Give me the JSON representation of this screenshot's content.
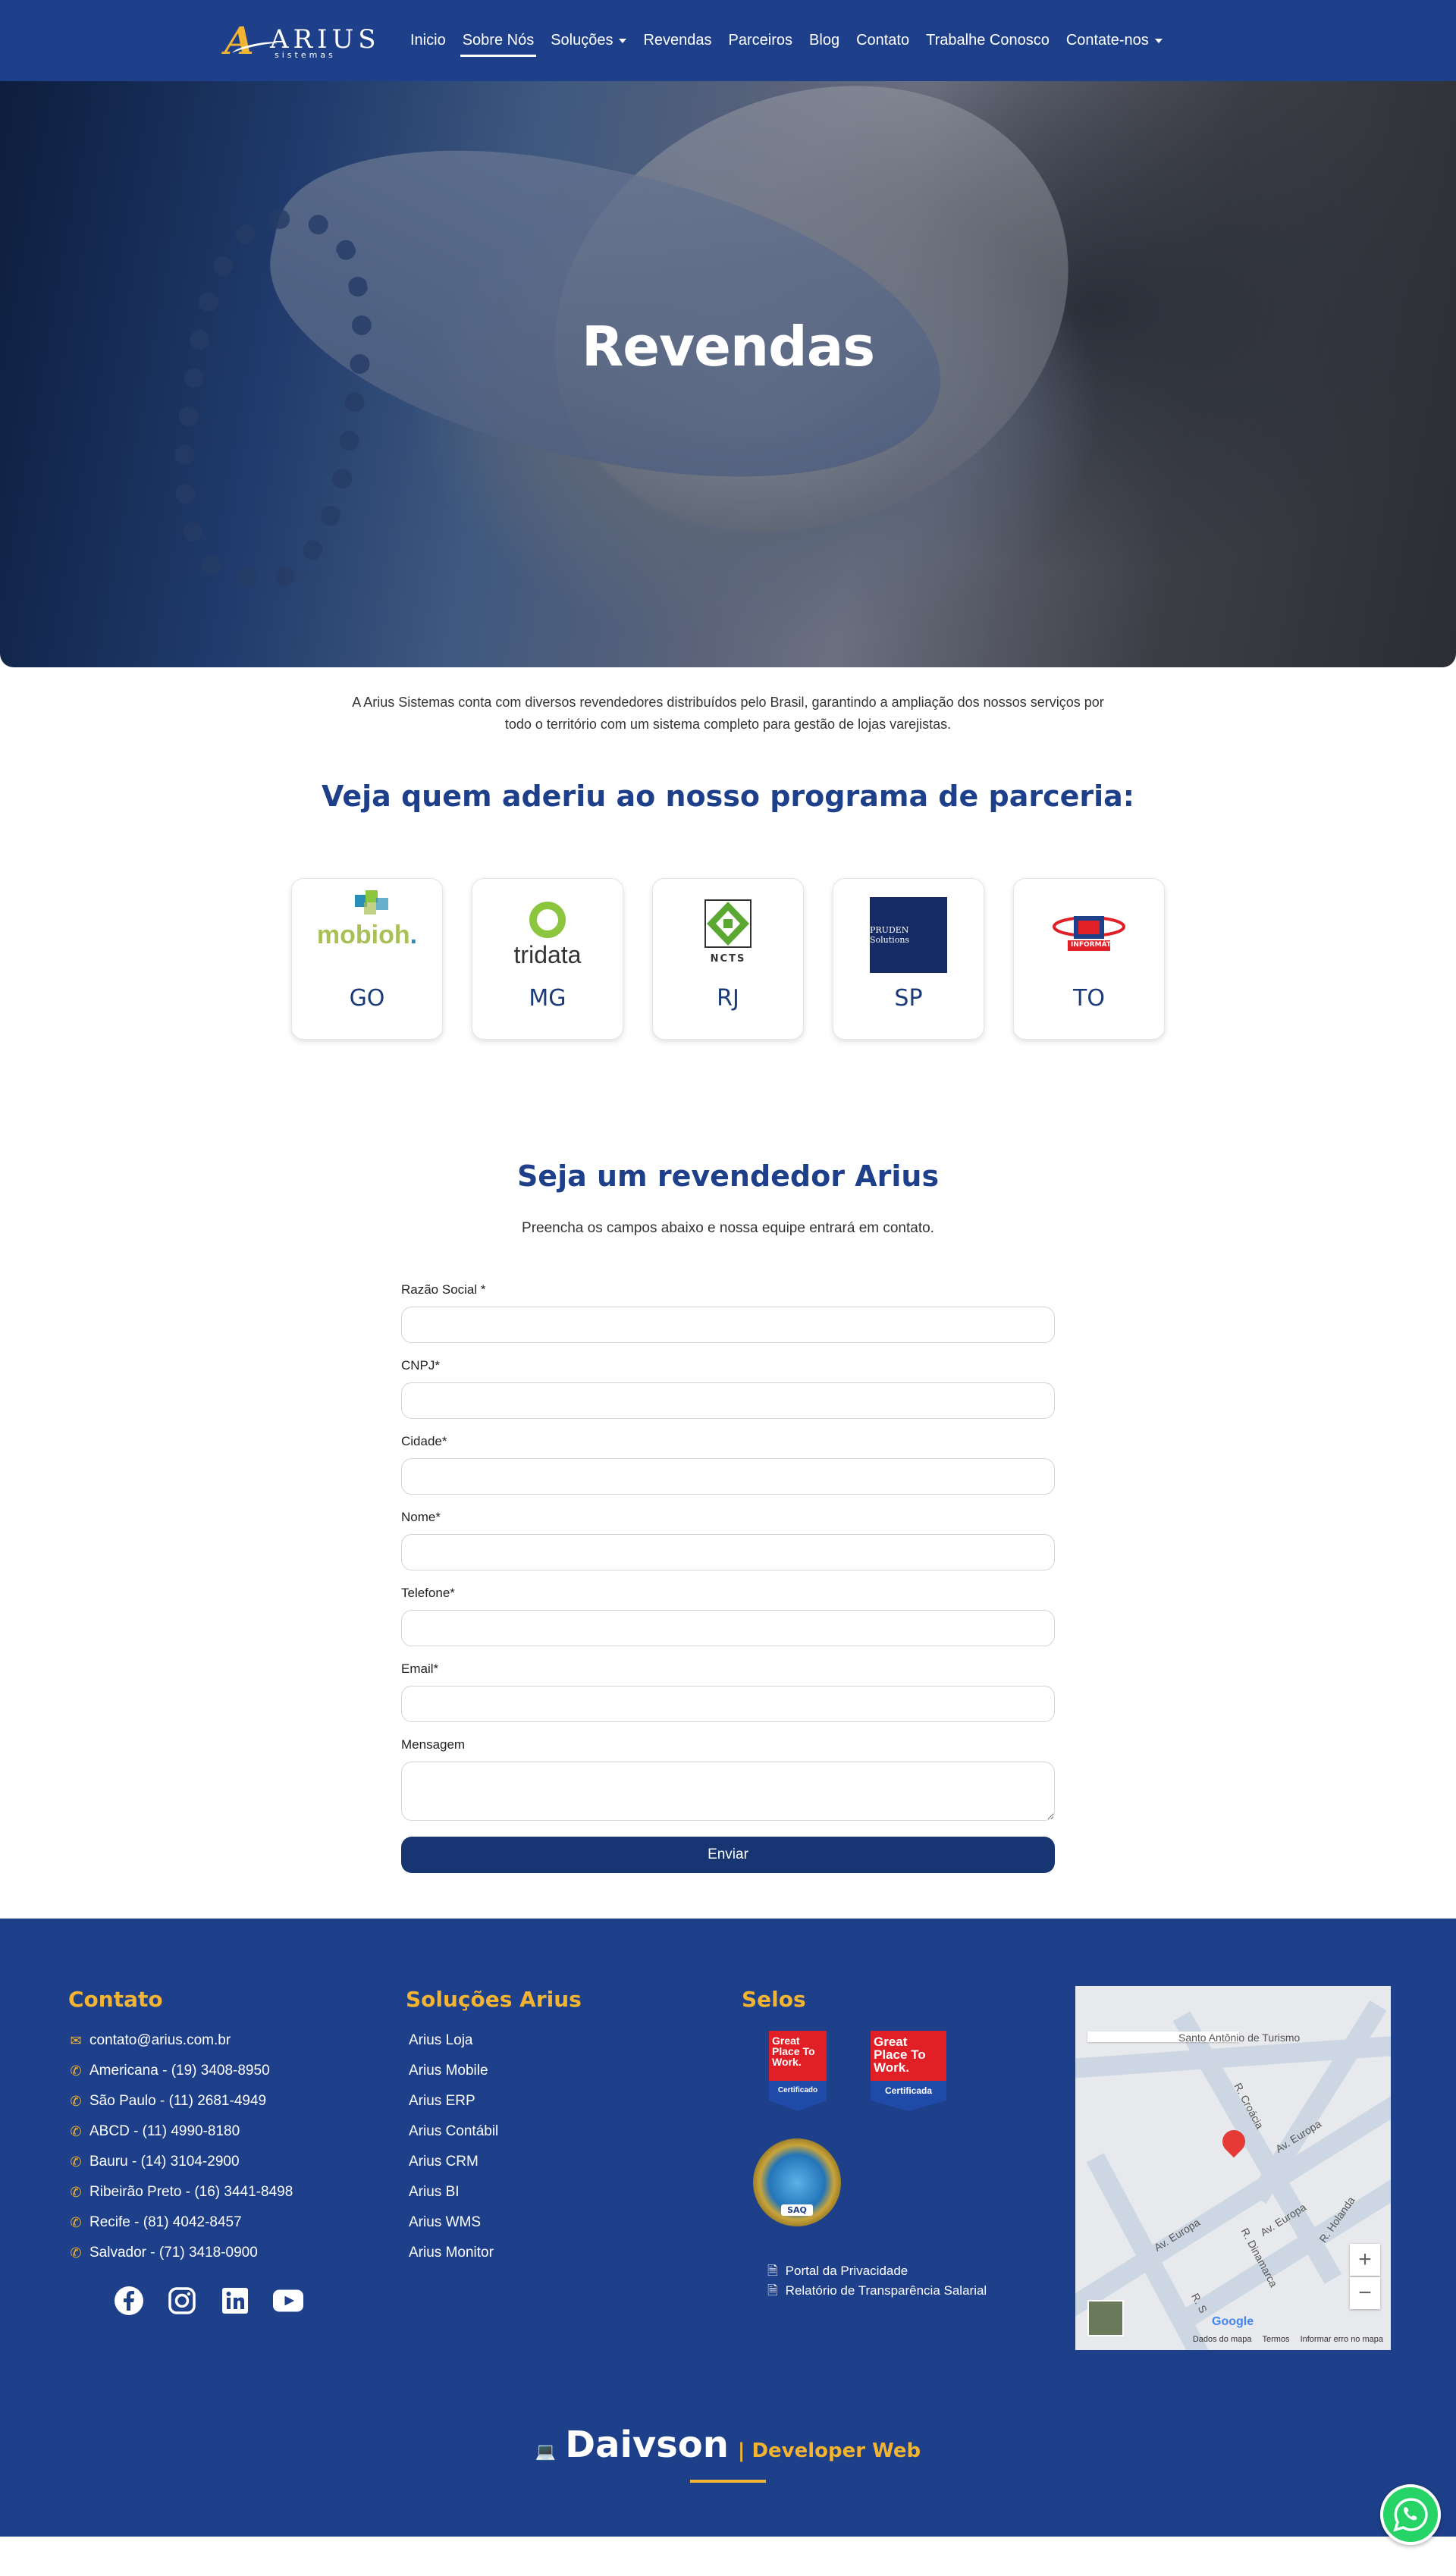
{
  "brand": {
    "name": "ARIUS",
    "tagline": "sistemas",
    "initial": "A"
  },
  "nav": {
    "items": [
      {
        "label": "Inicio",
        "dropdown": false,
        "active": false
      },
      {
        "label": "Sobre Nós",
        "dropdown": false,
        "active": true
      },
      {
        "label": "Soluções",
        "dropdown": true,
        "active": false
      },
      {
        "label": "Revendas",
        "dropdown": false,
        "active": false
      },
      {
        "label": "Parceiros",
        "dropdown": false,
        "active": false
      },
      {
        "label": "Blog",
        "dropdown": false,
        "active": false
      },
      {
        "label": "Contato",
        "dropdown": false,
        "active": false
      },
      {
        "label": "Trabalhe Conosco",
        "dropdown": false,
        "active": false
      },
      {
        "label": "Contate-nos",
        "dropdown": true,
        "active": false
      }
    ]
  },
  "hero": {
    "title": "Revendas"
  },
  "intro": {
    "text": "A Arius Sistemas conta com diversos revendedores distribuídos pelo Brasil, garantindo a ampliação dos nossos serviços por todo o território com um sistema completo para gestão de lojas varejistas."
  },
  "partners": {
    "title": "Veja quem aderiu ao nosso programa de parceria:",
    "cards": [
      {
        "state": "GO",
        "logo": "mobioh.",
        "logo_text": "mobioh"
      },
      {
        "state": "MG",
        "logo": "tridata",
        "logo_text": "tridata"
      },
      {
        "state": "RJ",
        "logo": "ncts",
        "logo_text": "NCTS"
      },
      {
        "state": "SP",
        "logo": "prudent-solutions",
        "logo_text": "PRUDEN Solutions"
      },
      {
        "state": "TO",
        "logo": "informatica",
        "logo_text": "INFORMÁTICA"
      }
    ]
  },
  "form": {
    "title": "Seja um revendedor Arius",
    "subtitle": "Preencha os campos abaixo e nossa equipe entrará em contato.",
    "fields": {
      "razao": "Razão Social *",
      "cnpj": "CNPJ*",
      "cidade": "Cidade*",
      "nome": "Nome*",
      "telefone": "Telefone*",
      "email": "Email*",
      "mensagem": "Mensagem"
    },
    "submit_label": "Enviar"
  },
  "footer": {
    "contact": {
      "title": "Contato",
      "email": "contato@arius.com.br",
      "phones": [
        "Americana - (19) 3408-8950",
        "São Paulo - (11) 2681-4949",
        "ABCD - (11) 4990-8180",
        "Bauru - (14) 3104-2900",
        "Ribeirão Preto - (16) 3441-8498",
        "Recife - (81) 4042-8457",
        "Salvador - (71) 3418-0900"
      ]
    },
    "solutions": {
      "title": "Soluções Arius",
      "items": [
        "Arius Loja",
        "Arius Mobile",
        "Arius ERP",
        "Arius Contábil",
        "Arius CRM",
        "Arius BI",
        "Arius WMS",
        "Arius Monitor"
      ]
    },
    "seals": {
      "title": "Selos",
      "gptw_text": "Great Place To Work.",
      "gptw_cert": "Certificado",
      "gptw_cert2": "Certificada",
      "saq": "SAQ",
      "links": [
        "Portal da Privacidade",
        "Relatório de Transparência Salarial"
      ]
    },
    "map": {
      "labels": [
        "Santo Antônio de Turismo",
        "R. Croácia",
        "Av. Europa",
        "Av. Europa",
        "R. Dinamarca",
        "R. Holanda",
        "Av. Europa",
        "R. S"
      ],
      "footer": [
        "Dados do mapa",
        "Termos",
        "Informar erro no mapa"
      ],
      "google": "Google"
    },
    "credit": {
      "name": "Daivson",
      "subtitle": "| Developer Web"
    }
  },
  "colors": {
    "primary": "#1e3f8a",
    "accent": "#f3b431",
    "button": "#173573",
    "whatsapp": "#25d366"
  }
}
